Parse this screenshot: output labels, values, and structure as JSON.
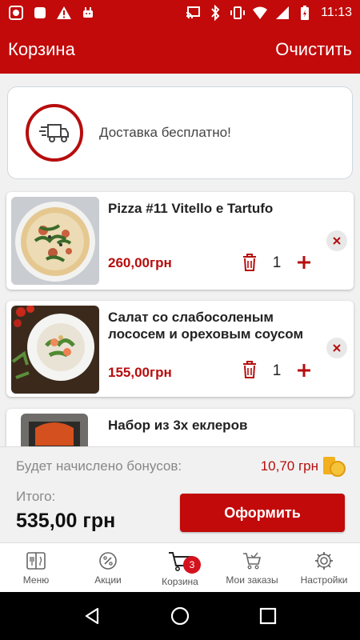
{
  "status_bar": {
    "time": "11:13",
    "left_icons": [
      "screen-record-icon",
      "notification-square-icon",
      "warning-icon",
      "android-icon"
    ],
    "right_icons": [
      "cast-icon",
      "bluetooth-icon",
      "vibrate-icon",
      "wifi-icon",
      "signal-icon",
      "battery-charging-icon"
    ]
  },
  "app_bar": {
    "title": "Корзина",
    "clear_label": "Очистить"
  },
  "delivery": {
    "text": "Доставка бесплатно!",
    "icon": "delivery-truck-icon"
  },
  "cart": {
    "items": [
      {
        "name": "Pizza #11 Vitello e Tartufo",
        "price": "260,00грн",
        "qty": "1"
      },
      {
        "name": "Салат со слабосоленым лососем и ореховым соусом",
        "price": "155,00грн",
        "qty": "1"
      },
      {
        "name": "Набор из 3х еклеров",
        "price": "",
        "qty": ""
      }
    ]
  },
  "summary": {
    "bonus_label": "Будет начислено бонусов:",
    "bonus_value": "10,70 грн",
    "total_label": "Итого:",
    "total_value": "535,00 грн",
    "order_button": "Оформить"
  },
  "bottom_nav": {
    "items": [
      {
        "label": "Меню",
        "icon": "menu-book-icon"
      },
      {
        "label": "Акции",
        "icon": "discount-icon"
      },
      {
        "label": "Корзина",
        "icon": "cart-icon",
        "badge": "3"
      },
      {
        "label": "Мои заказы",
        "icon": "orders-cart-icon"
      },
      {
        "label": "Настройки",
        "icon": "gear-icon"
      }
    ]
  },
  "colors": {
    "brand_red": "#c20a0a",
    "price_red": "#b70d0d",
    "bonus_coin": "#f2b01e"
  }
}
